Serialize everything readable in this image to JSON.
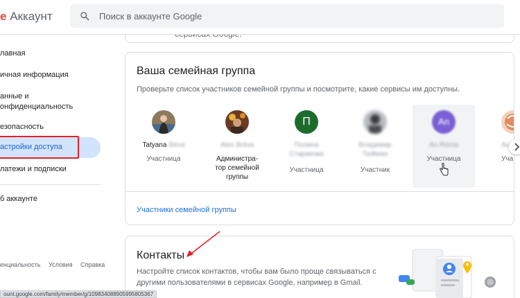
{
  "header": {
    "brand_g": "e",
    "brand_text": "Аккаунт",
    "search_placeholder": "Поиск в аккаунте Google"
  },
  "prev_card": {
    "text": "сервисах Google."
  },
  "sidebar": {
    "items": [
      {
        "label": "лавная"
      },
      {
        "label": "ичная информация"
      },
      {
        "label": "анные и"
      },
      {
        "label": "онфиденциальность"
      },
      {
        "label": "езопасность"
      },
      {
        "label": "астройки доступа"
      },
      {
        "label": "латежи и подписки"
      },
      {
        "label": "б аккаунте"
      }
    ],
    "footer": [
      "енциальность",
      "Условия",
      "Справка"
    ]
  },
  "status_url": "ount.google.com/family/member/g/109834088905995805367",
  "family": {
    "title": "Ваша семейная группа",
    "description": "Проверьте список участников семейной группы и посмотрите, какие сервисы им доступны.",
    "link": "Участники семейной группы",
    "members": [
      {
        "first": "Tatyana",
        "last": "Ilieva",
        "role": "Участница"
      },
      {
        "name": "Alex Britva",
        "role": "Администра-\nтор семейной\nгруппы"
      },
      {
        "initial": "П",
        "name": "Полина\nСтарикова",
        "role": "Участница"
      },
      {
        "name": "Владимир\nТюйман",
        "role": "Участник"
      },
      {
        "initial": "An",
        "name": "An Roma",
        "role": "Участница"
      },
      {
        "name": "Ан",
        "role": "Уча"
      }
    ]
  },
  "contacts": {
    "title": "Контакты",
    "description_1": "Настройте список контактов, чтобы вам было проще связываться с",
    "description_2": "другими пользователями в сервисах Google, например в Gmail."
  },
  "colors": {
    "accent": "#1a73e8",
    "active_bg": "#d2e3fc",
    "highlight": "#e3202a",
    "green_avatar": "#1e6b2e",
    "purple_avatar": "#7b61d6"
  }
}
